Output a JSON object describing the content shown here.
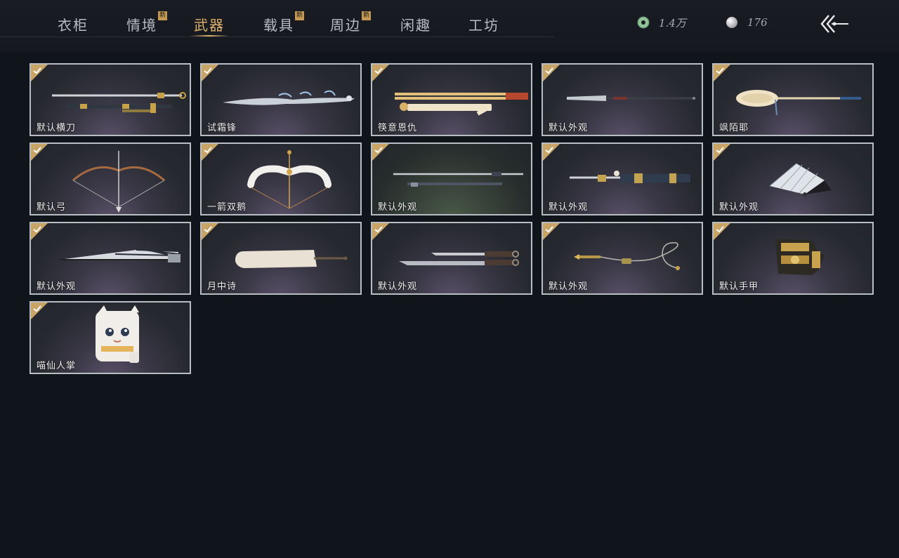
{
  "tabs": [
    {
      "label": "衣柜",
      "new": false,
      "active": false
    },
    {
      "label": "情境",
      "new": true,
      "active": false
    },
    {
      "label": "武器",
      "new": false,
      "active": true
    },
    {
      "label": "载具",
      "new": true,
      "active": false
    },
    {
      "label": "周边",
      "new": true,
      "active": false
    },
    {
      "label": "闲趣",
      "new": false,
      "active": false
    },
    {
      "label": "工坊",
      "new": false,
      "active": false
    }
  ],
  "new_badge": "新",
  "currency": {
    "jade": "1.4万",
    "pearl": "176"
  },
  "items": [
    {
      "label": "默认横刀",
      "icon": "sheathed-saber-icon"
    },
    {
      "label": "试霜锋",
      "icon": "frost-blade-icon"
    },
    {
      "label": "筷意恩仇",
      "icon": "chopsticks-weapon-icon"
    },
    {
      "label": "默认外观",
      "icon": "long-spear-icon"
    },
    {
      "label": "飒陌耶",
      "icon": "spoon-staff-icon"
    },
    {
      "label": "默认弓",
      "icon": "bow-icon"
    },
    {
      "label": "一箭双鹅",
      "icon": "goose-bow-icon"
    },
    {
      "label": "默认外观",
      "icon": "twin-swords-icon"
    },
    {
      "label": "默认外观",
      "icon": "ornate-sword-icon"
    },
    {
      "label": "默认外观",
      "icon": "folding-fan-icon"
    },
    {
      "label": "默认外观",
      "icon": "umbrella-icon"
    },
    {
      "label": "月中诗",
      "icon": "parasol-icon"
    },
    {
      "label": "默认外观",
      "icon": "dual-daggers-icon"
    },
    {
      "label": "默认外观",
      "icon": "rope-dart-icon"
    },
    {
      "label": "默认手甲",
      "icon": "gauntlet-icon"
    },
    {
      "label": "喵仙人掌",
      "icon": "cat-paw-gauntlet-icon"
    }
  ],
  "colors": {
    "accent_gold": "#e0b26d",
    "check_gold": "#c9a467",
    "card_border": "#b9bdc4",
    "background": "#10141b"
  }
}
